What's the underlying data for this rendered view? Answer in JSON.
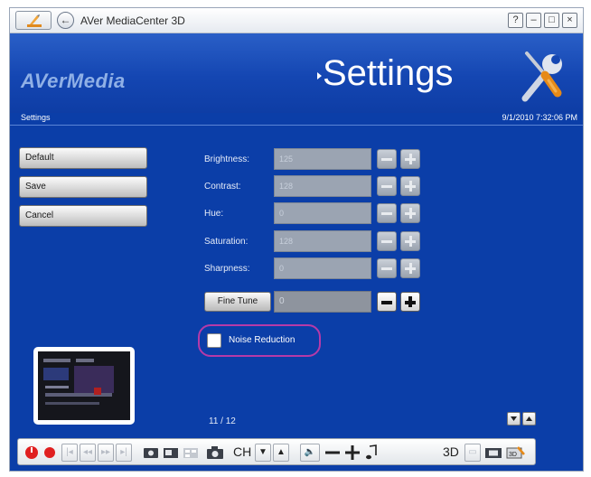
{
  "window": {
    "title": "AVer MediaCenter 3D",
    "controls": {
      "help": "?",
      "minimize": "–",
      "maximize": "□",
      "close": "×"
    },
    "back_glyph": "←"
  },
  "header": {
    "brand": "AVerMedia",
    "title": "Settings",
    "icon": "tools-icon"
  },
  "status": {
    "breadcrumb": "Settings",
    "datetime": "9/1/2010 7:32:06 PM"
  },
  "side_buttons": [
    {
      "label": "Default"
    },
    {
      "label": "Save"
    },
    {
      "label": "Cancel"
    }
  ],
  "settings": [
    {
      "label": "Brightness:",
      "value": "125"
    },
    {
      "label": "Contrast:",
      "value": "128"
    },
    {
      "label": "Hue:",
      "value": "0"
    },
    {
      "label": "Saturation:",
      "value": "128"
    },
    {
      "label": "Sharpness:",
      "value": "0"
    }
  ],
  "fine_tune": {
    "label": "Fine Tune",
    "value": "0"
  },
  "noise_reduction": {
    "label": "Noise Reduction",
    "checked": false
  },
  "pagination": {
    "text": "11 / 12"
  },
  "toolbar": {
    "ch_label": "CH",
    "mode_label": "3D"
  },
  "colors": {
    "background": "#0b3ea8",
    "highlight_ring": "#b63aa8",
    "record_red": "#e02020"
  }
}
